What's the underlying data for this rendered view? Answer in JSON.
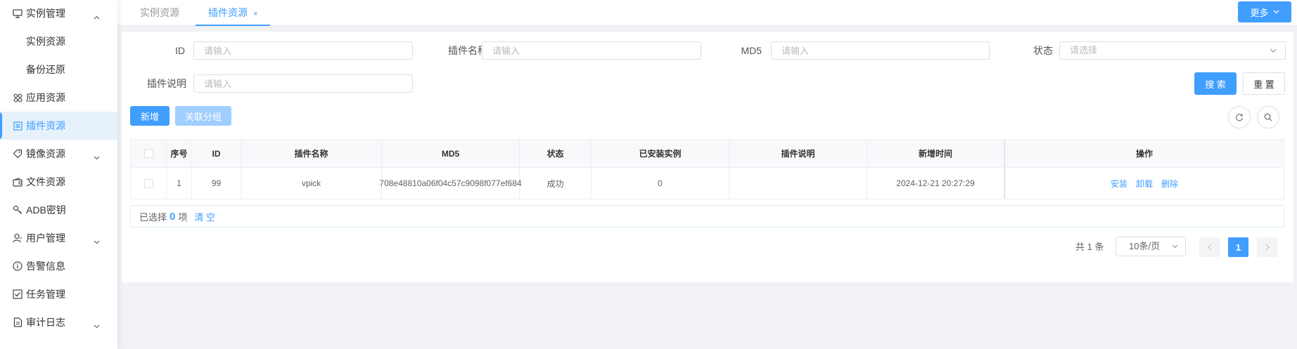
{
  "sidebar": {
    "items": [
      {
        "label": "实例管理",
        "icon": "monitor-icon",
        "expanded": true
      },
      {
        "label": "实例资源",
        "sub": true
      },
      {
        "label": "备份还原",
        "sub": true
      },
      {
        "label": "应用资源",
        "icon": "apps-grid-icon"
      },
      {
        "label": "插件资源",
        "icon": "plugin-list-icon",
        "active": true
      },
      {
        "label": "镜像资源",
        "icon": "tag-icon",
        "has_children": true
      },
      {
        "label": "文件资源",
        "icon": "wallet-icon"
      },
      {
        "label": "ADB密钥",
        "icon": "key-icon"
      },
      {
        "label": "用户管理",
        "icon": "user-icon",
        "has_children": true
      },
      {
        "label": "告警信息",
        "icon": "info-circle-icon"
      },
      {
        "label": "任务管理",
        "icon": "checkbox-icon"
      },
      {
        "label": "审计日志",
        "icon": "document-icon",
        "has_children": true
      }
    ]
  },
  "tabs": [
    {
      "label": "实例资源"
    },
    {
      "label": "插件资源",
      "active": true,
      "close": "×"
    }
  ],
  "more_button": "更多",
  "filters": {
    "id_label": "ID",
    "name_label": "插件名称",
    "md5_label": "MD5",
    "status_label": "状态",
    "desc_label": "插件说明",
    "input_placeholder": "请输入",
    "select_placeholder": "请选择"
  },
  "buttons": {
    "search": "搜 索",
    "reset": "重 置",
    "add": "新增",
    "link_group": "关联分组"
  },
  "table": {
    "headers": [
      "序号",
      "ID",
      "插件名称",
      "MD5",
      "状态",
      "已安装实例",
      "插件说明",
      "新增时间",
      "操作"
    ],
    "rows": [
      {
        "index": "1",
        "id": "99",
        "name": "vpick",
        "md5": "708e48810a06f04c57c9098f077ef684",
        "status": "成功",
        "installed": "0",
        "desc": "",
        "created": "2024-12-21 20:27:29",
        "actions": [
          "安装",
          "卸载",
          "删除"
        ]
      }
    ]
  },
  "selection": {
    "prefix": "已选择",
    "count": "0",
    "suffix": "项",
    "clear": "清 空"
  },
  "pagination": {
    "total": "共 1 条",
    "page_size": "10条/页",
    "current_page": "1"
  },
  "colors": {
    "primary": "#409eff",
    "disabled": "#a0cfff",
    "active_bg": "#e6f1fc"
  }
}
